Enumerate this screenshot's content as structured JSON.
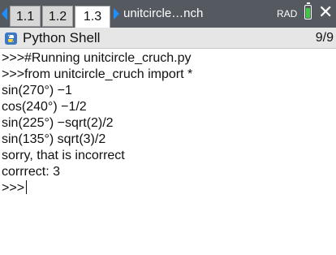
{
  "topbar": {
    "tabs": [
      {
        "label": "1.1",
        "active": false
      },
      {
        "label": "1.2",
        "active": false
      },
      {
        "label": "1.3",
        "active": true
      }
    ],
    "document_name": "unitcircle…nch",
    "angle_mode": "RAD",
    "close_symbol": "✕"
  },
  "header": {
    "app_icon": "python-icon",
    "title": "Python Shell",
    "page_indicator": "9/9"
  },
  "shell": {
    "lines": [
      ">>>#Running unitcircle_cruch.py",
      ">>>from unitcircle_cruch import *",
      "sin(270°) −1",
      "cos(240°) −1/2",
      "sin(225°) −sqrt(2)/2",
      "sin(135°) sqrt(3)/2",
      "sorry, that is incorrect",
      "corrrect: 3"
    ],
    "prompt": ">>>"
  },
  "colors": {
    "titlebar": "#545a60",
    "nav_arrow": "#1e8fff",
    "battery_fill": "#3ec93e",
    "python_blue": "#3b77c4"
  }
}
